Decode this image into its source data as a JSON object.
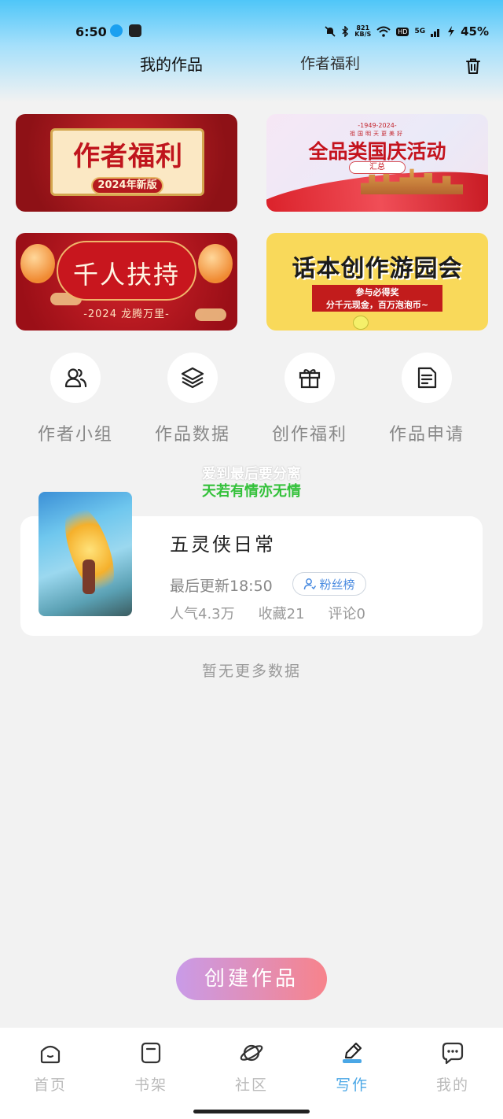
{
  "status_bar": {
    "time": "6:50",
    "net_speed_value": "821",
    "net_speed_unit": "KB/S",
    "hd": "HD",
    "signal": "5G",
    "battery": "45%"
  },
  "header": {
    "tabs": [
      {
        "label": "我的作品",
        "active": true
      },
      {
        "label": "作者福利",
        "active": false
      }
    ],
    "trash_icon": "trash-icon"
  },
  "banners": [
    {
      "title": "作者福利",
      "badge": "2024年新版"
    },
    {
      "year": "-1949-2024-",
      "sub": "祖国明天更美好",
      "title": "全品类国庆活动",
      "tag": "汇总"
    },
    {
      "title": "千人扶持",
      "sub": "-2024 龙腾万里-"
    },
    {
      "title": "话本创作游园会",
      "line1": "参与必得奖",
      "line2": "分千元现金，百万泡泡币~"
    }
  ],
  "quick_actions": [
    {
      "label": "作者小组",
      "icon": "users-icon"
    },
    {
      "label": "作品数据",
      "icon": "layers-icon"
    },
    {
      "label": "创作福利",
      "icon": "gift-icon"
    },
    {
      "label": "作品申请",
      "icon": "document-icon"
    }
  ],
  "promo": {
    "line1": "爱到最后要分离",
    "line2": "天若有情亦无情",
    "line2_color": "#33c13a"
  },
  "work": {
    "title": "五灵侠日常",
    "updated": "最后更新18:50",
    "fans_label": "粉丝榜",
    "stats": {
      "popularity": "人气4.3万",
      "favorites": "收藏21",
      "comments": "评论0"
    }
  },
  "no_more": "暂无更多数据",
  "create_button": "创建作品",
  "bottom_nav": [
    {
      "label": "首页",
      "icon": "home-icon",
      "active": false
    },
    {
      "label": "书架",
      "icon": "bookshelf-icon",
      "active": false
    },
    {
      "label": "社区",
      "icon": "planet-icon",
      "active": false
    },
    {
      "label": "写作",
      "icon": "write-icon",
      "active": true
    },
    {
      "label": "我的",
      "icon": "chat-bubble-icon",
      "active": false
    }
  ],
  "colors": {
    "accent": "#4aa7e6",
    "create_gradient_start": "#c99be8",
    "create_gradient_end": "#f7838b"
  }
}
